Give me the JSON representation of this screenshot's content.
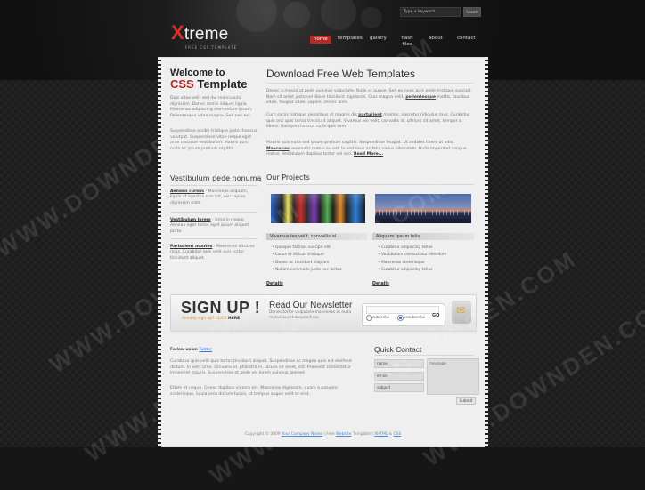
{
  "header": {
    "logo_x": "X",
    "logo_rest": "treme",
    "logo_sub": "FREE CSS TEMPLATE",
    "search_placeholder": "Type a keyword",
    "search_button": "Search"
  },
  "nav": {
    "items": [
      "home",
      "templates",
      "gallery",
      "flash files",
      "about",
      "contact"
    ],
    "active": "home"
  },
  "welcome": {
    "line1": "Welcome to",
    "line2a": "CSS",
    "line2b": " Template",
    "p1": "Duis vitae velit sed dui malesuada dignissim. Donec mollis aliquet ligula. Maecenas adipiscing elementum ipsum. Pellentesque vitae magna. Sed nec est.",
    "p2": "Suspendisse a nibh tristique justo rhoncus volutpat. Suspendisse vitae neque eget ante tristique vestibulum. Mauris quis nulla ac ipsum pretium sagittis."
  },
  "main": {
    "title": "Download Free Web Templates",
    "p1": "Donec a massa ut pede pulvinar vulputate. Nulla et augue. Sed eu nunc quis pede tristique suscipit. Nam sit amet justo vel libero tincidunt dignissim. Cras magna velit,",
    "p1_link": "pellentesque",
    "p1_rest": " mattis, faucibus vitae, feugiat vitae, sapien. Donec ante.",
    "p2": "Cum sociis natoque penatibus et magnis dis",
    "p2_link": "parturient",
    "p2_rest": " montes, nascetur ridiculus mus. Curabitur quis orci quis tortor tincidunt aliquet. Vivamus leo velit, convallis id, ultrices sit amet, tempor a, libero. Quisque rhoncus nulla quis sem.",
    "p3": "Mauris quis nulla sed ipsum pretium sagittis. Suspendisse feugiat. Ut sodales libero ut odio.",
    "p3_link": "Maecenas",
    "p3_rest": " venenatis metus eu est. In sed risus ac felis varius bibendum. Nulla imperdiet congue metus. Vestibulum dapibus tortor vel orci.",
    "read_more": "Read More..."
  },
  "sidebar": {
    "title": "Vestibulum pede nonuma",
    "entries": [
      {
        "key": "Aenean cursus",
        "text": " - Maecenas aliquam, ligula et egestas suscipit, nisi sapien dignissim nibh."
      },
      {
        "key": "Vestibulum lorem",
        "text": " - Urna in neque. Aenean eget tortor eget ipsum aliquet porta."
      },
      {
        "key": "Parturient montes",
        "text": " - Maecenas ultricies risus. Curabitur quis velit quis tortor tincidunt aliquet."
      }
    ]
  },
  "projects": {
    "title": "Our Projects",
    "items": [
      {
        "label": "Vivamus leo velit, convallis id",
        "bullets": [
          "Quisque facilisis suscipit elit",
          "Lacus et dictum tristique",
          "Donec ac tincidunt aliquam",
          "Nullam commodo justo nec lectus"
        ],
        "details": "Details"
      },
      {
        "label": "Aliquam ipsum felis",
        "bullets": [
          "Curabitur adipiscing tellus",
          "Vestibulum consectetur interdum",
          "Maecenas scelerisque",
          "Curabitur adipiscing tellus"
        ],
        "details": "Details"
      }
    ]
  },
  "signup": {
    "title": "SIGN UP !",
    "sub_a": "Already sign up? ",
    "sub_b": "CLICK ",
    "sub_c": "HERE",
    "news_title": "Read Our Newsletter",
    "news_text": "Donec tortor vulputate maecenas et nulla metus auset suspendisse.",
    "subscribe": "subscribe",
    "unsubscribe": "unsubscribe",
    "go": "GO"
  },
  "follow": {
    "label": "Follow us on ",
    "link": "Twitter",
    "p1": "Curabitur quis velit quis tortor tincidunt aliquet. Suspendisse ac magna quis est eleifend dictum. In velit urna, convallis id, pharetra in, iaculis sit amet, est. Praesent consectetur imperdiet mauris. Suspendisse et pede vel lorem pulvinar laoreet.",
    "p2": "Etiam et neque. Donec dapibus viverra est. Maecenas dignissim, quam a posuere scelerisque, ligula arcu dictum turpis, ut tempus augue velit et erat."
  },
  "contact": {
    "title": "Quick Contact",
    "name": "name",
    "email": "email",
    "subject": "subject",
    "message": "message",
    "submit": "Submit"
  },
  "footer": {
    "text": "Copyright © 2009 ",
    "link1": "Your Company Name",
    "mid": " | Free ",
    "link2": "Website",
    "tail": " Template | ",
    "link3": "XHTML",
    "amp": " & ",
    "link4": "CSS"
  },
  "watermark": "WWW.DOWNDEN.COM"
}
